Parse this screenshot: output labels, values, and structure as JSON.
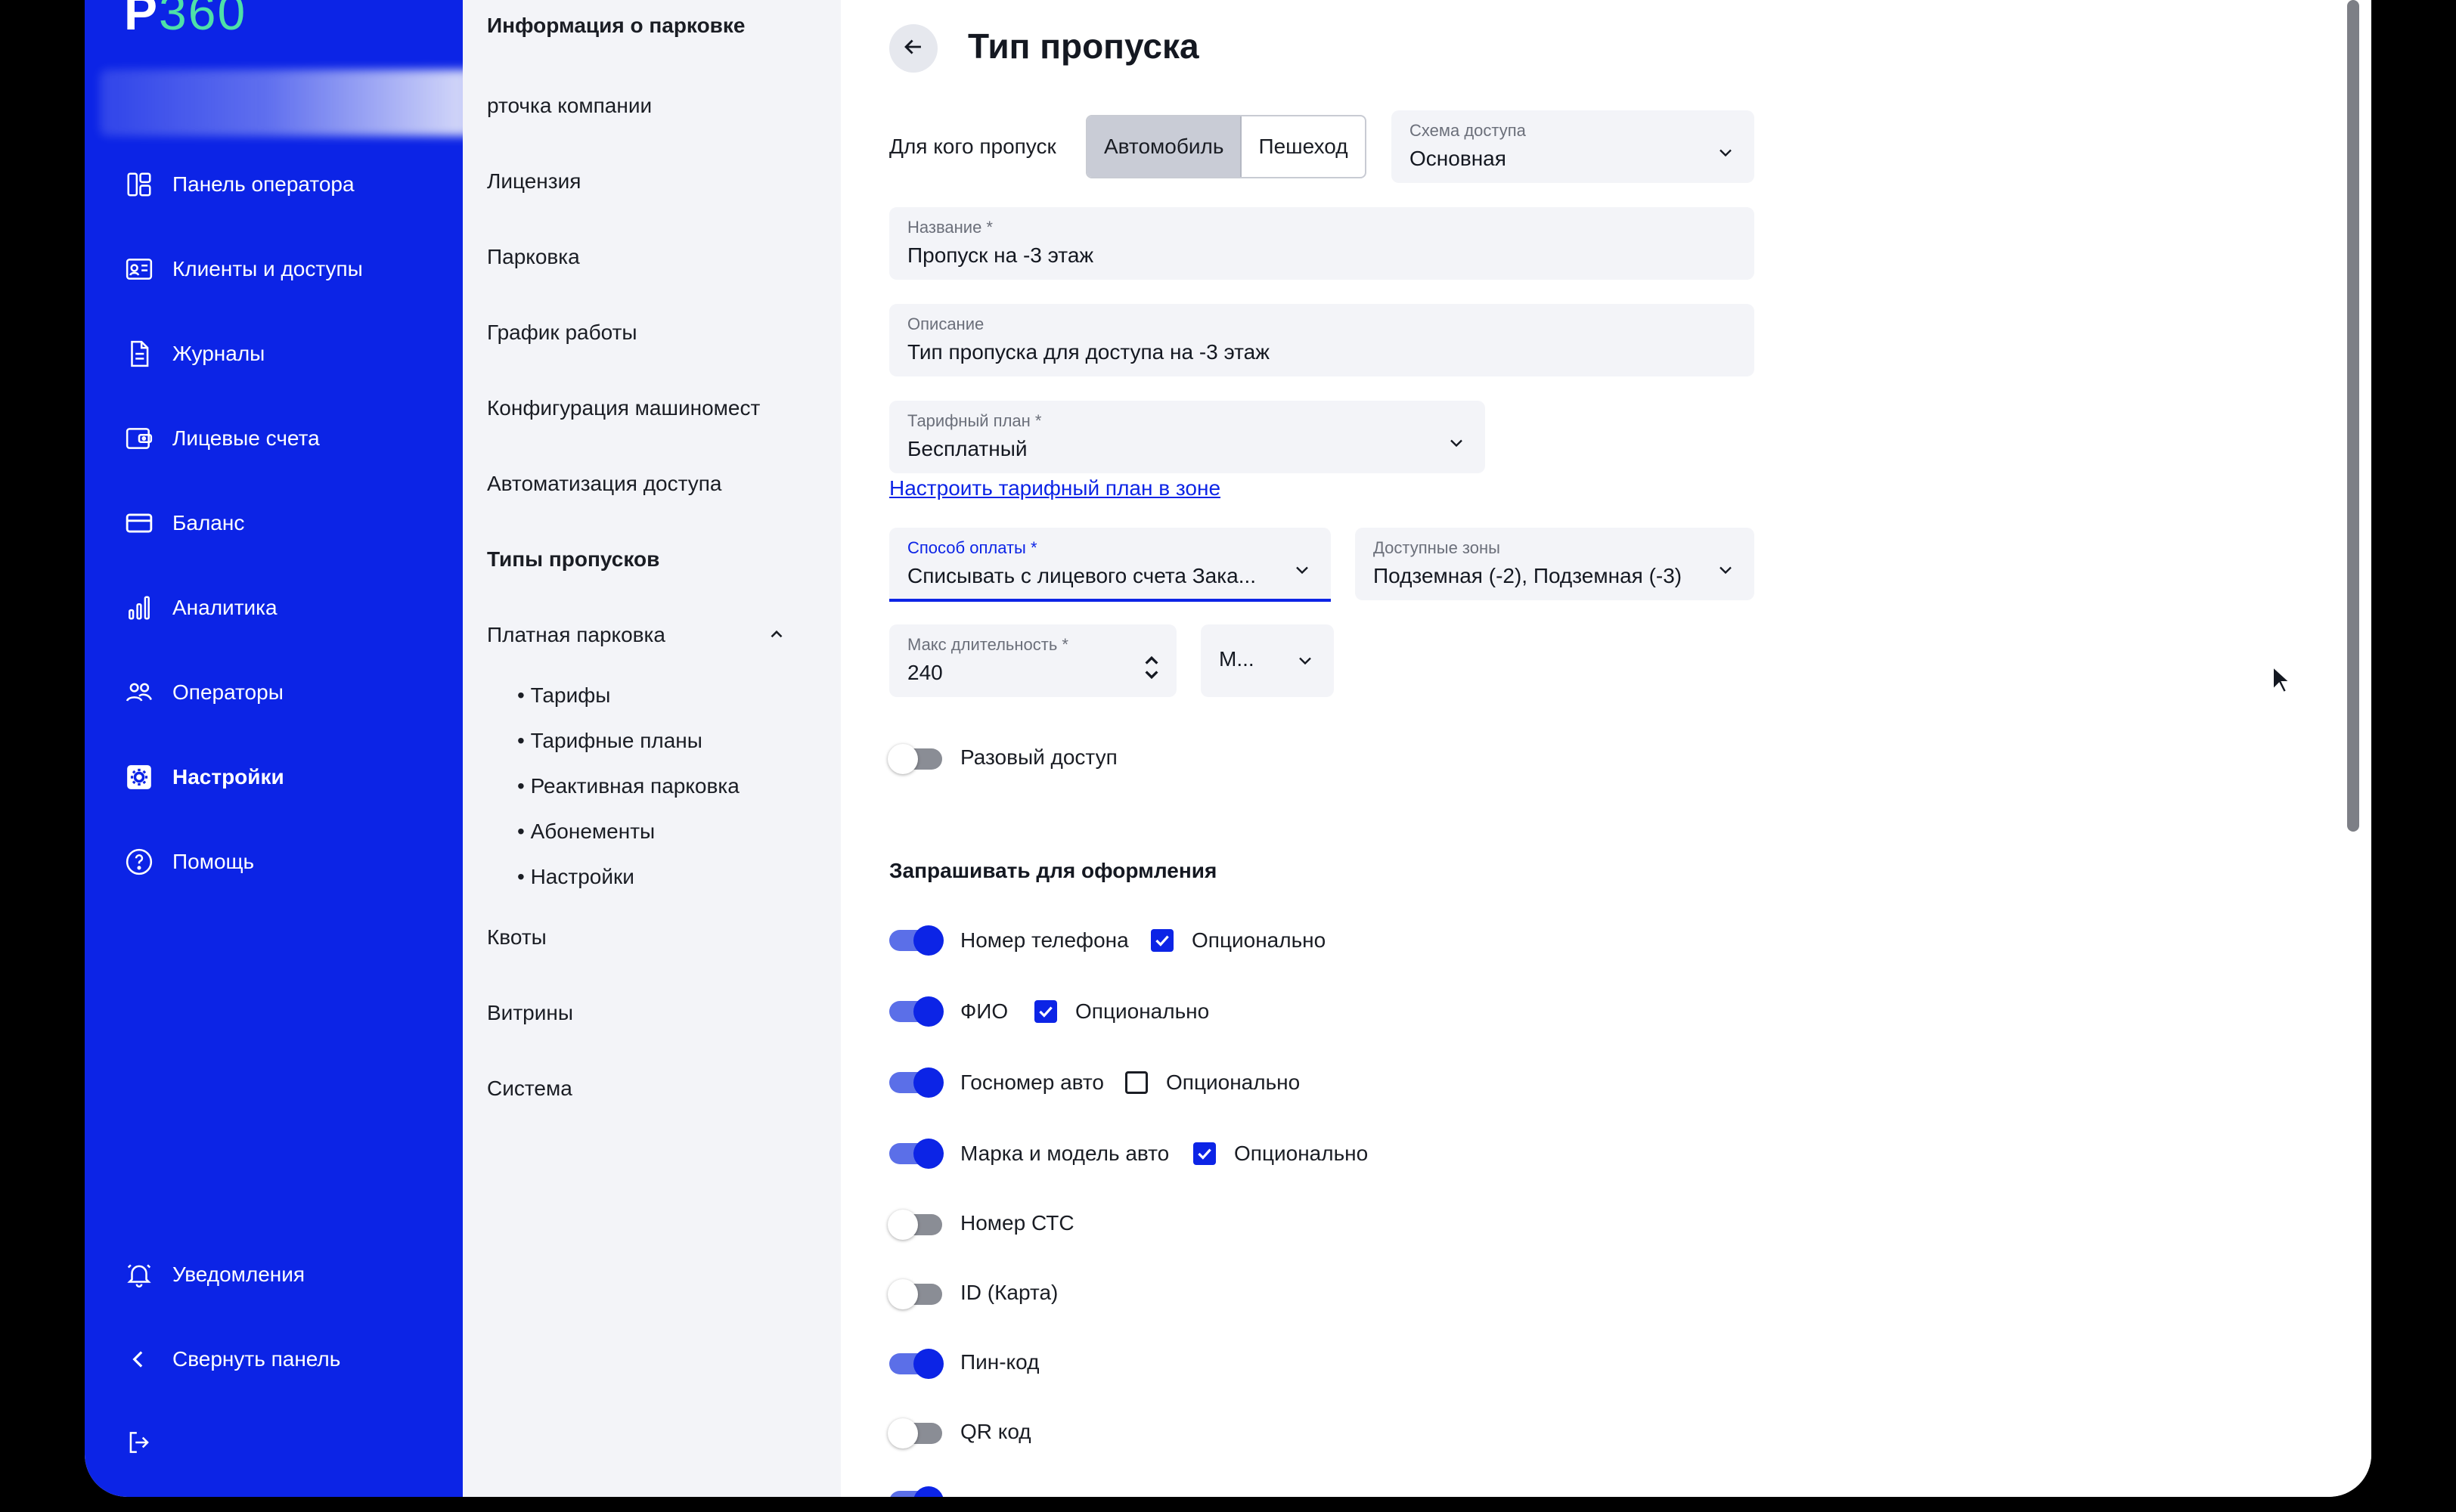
{
  "app": {
    "logo_p": "P",
    "logo_n": "360"
  },
  "sidebar": {
    "items": [
      {
        "label": "Панель оператора",
        "icon": "dashboard-icon"
      },
      {
        "label": "Клиенты и доступы",
        "icon": "id-card-icon"
      },
      {
        "label": "Журналы",
        "icon": "document-icon"
      },
      {
        "label": "Лицевые счета",
        "icon": "wallet-icon"
      },
      {
        "label": "Баланс",
        "icon": "card-icon"
      },
      {
        "label": "Аналитика",
        "icon": "bar-chart-icon"
      },
      {
        "label": "Операторы",
        "icon": "users-icon"
      },
      {
        "label": "Настройки",
        "icon": "settings-icon",
        "active": true
      },
      {
        "label": "Помощь",
        "icon": "help-icon"
      }
    ],
    "notifications": "Уведомления",
    "collapse": "Свернуть панель"
  },
  "subnav": {
    "header": "Информация о парковке",
    "items": {
      "company": "Карточка компании",
      "company_visible": "рточка компании",
      "license": "Лицензия",
      "parking": "Парковка",
      "schedule": "График работы",
      "spaces": "Конфигурация машиномест",
      "automation": "Автоматизация доступа",
      "pass_types": "Типы пропусков",
      "paid": "Платная парковка",
      "quotas": "Квоты",
      "showcases": "Витрины",
      "system": "Система"
    },
    "paid_children": [
      "• Тарифы",
      "• Тарифные планы",
      "• Реактивная парковка",
      "• Абонементы",
      "• Настройки"
    ]
  },
  "page": {
    "title": "Тип пропуска",
    "for_whom_label": "Для кого пропуск",
    "segment": {
      "car": "Автомобиль",
      "pedestrian": "Пешеход",
      "selected": "Автомобиль"
    },
    "access_scheme": {
      "label": "Схема доступа",
      "value": "Основная"
    },
    "name": {
      "label": "Название *",
      "value": "Пропуск на -3 этаж"
    },
    "description": {
      "label": "Описание",
      "value": "Тип пропуска для доступа на -3 этаж"
    },
    "tariff_plan": {
      "label": "Тарифный план *",
      "value": "Бесплатный"
    },
    "tariff_link": "Настроить тарифный план в зоне",
    "payment": {
      "label": "Способ оплаты *",
      "value": "Списывать с лицевого счета Зака..."
    },
    "zones": {
      "label": "Доступные зоны",
      "value": "Подземная (-2), Подземная (-3)"
    },
    "max_duration": {
      "label": "Макс длительность *",
      "value": "240"
    },
    "duration_unit": {
      "value": "М..."
    },
    "one_time": {
      "label": "Разовый доступ",
      "on": false
    },
    "request_title": "Запрашивать для оформления",
    "optional_label": "Опционально",
    "requests": [
      {
        "label": "Номер телефона",
        "on": true,
        "optional": true
      },
      {
        "label": "ФИО",
        "on": true,
        "optional": true
      },
      {
        "label": "Госномер авто",
        "on": true,
        "optional": false
      },
      {
        "label": "Марка и модель авто",
        "on": true,
        "optional": true
      },
      {
        "label": "Номер СТС",
        "on": false
      },
      {
        "label": "ID (Карта)",
        "on": false
      },
      {
        "label": "Пин-код",
        "on": true
      },
      {
        "label": "QR код",
        "on": false
      }
    ]
  }
}
